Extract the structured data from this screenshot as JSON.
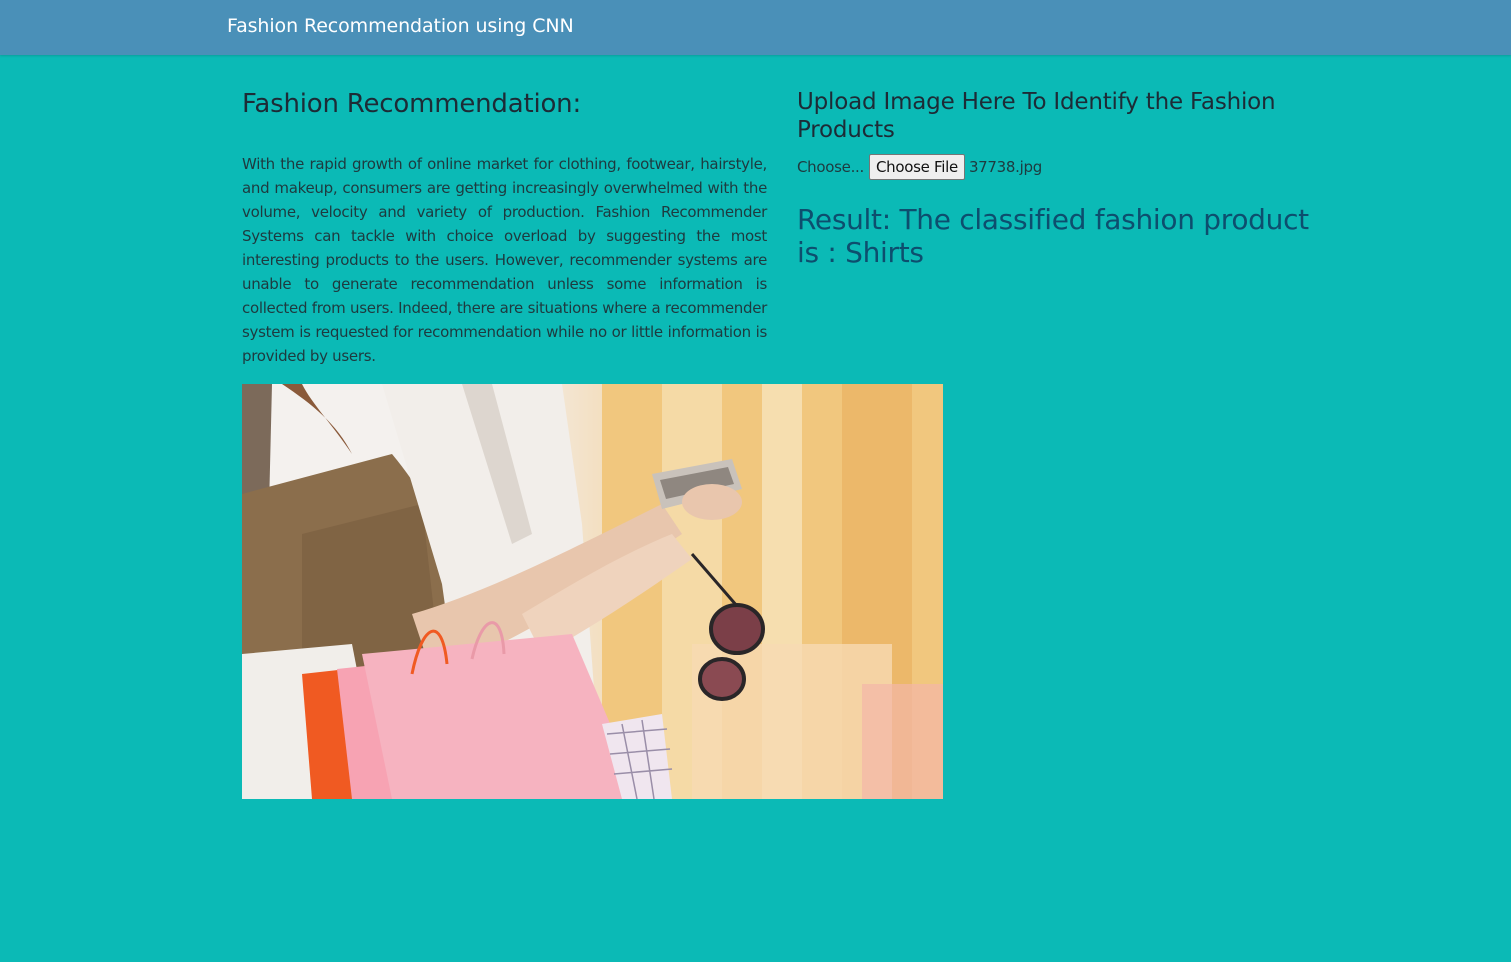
{
  "navbar": {
    "brand": "Fashion Recommendation using CNN"
  },
  "intro": {
    "title": "Fashion Recommendation:",
    "description": "With the rapid growth of online market for clothing, footwear, hairstyle, and makeup, consumers are getting increasingly overwhelmed with the volume, velocity and variety of production. Fashion Recommender Systems can tackle with choice overload by suggesting the most interesting products to the users. However, recommender systems are unable to generate recommendation unless some information is collected from users. Indeed, there are situations where a recommender system is requested for recommendation while no or little information is provided by users."
  },
  "upload": {
    "title": "Upload Image Here To Identify the Fashion Products",
    "choose_label": "Choose...",
    "button_label": "Choose File",
    "file_name": "37738.jpg"
  },
  "result": {
    "text": "Result: The classified fashion product is : Shirts"
  },
  "hero_image": {
    "icon": "shopping-woman-photo"
  },
  "colors": {
    "background": "#0bbab6",
    "navbar": "#4a90b8",
    "result_text": "#0d4e6e"
  }
}
